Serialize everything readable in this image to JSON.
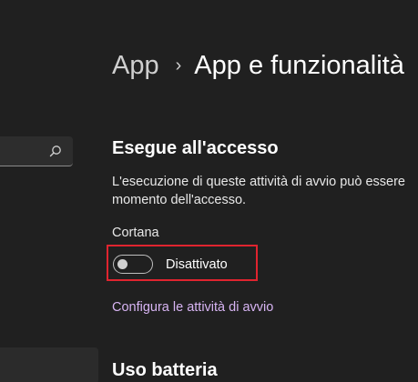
{
  "breadcrumb": {
    "parent": "App",
    "separator": "›",
    "current": "App e funzionalità"
  },
  "startup": {
    "title": "Esegue all'accesso",
    "description": "L'esecuzione di queste attività di avvio può essere\nmomento dell'accesso.",
    "app_name": "Cortana",
    "toggle_state": "Disattivato",
    "toggle_on": false,
    "configure_link": "Configura le attività di avvio"
  },
  "battery": {
    "title": "Uso batteria"
  },
  "search": {
    "icon": "search-icon"
  },
  "colors": {
    "background": "#202020",
    "link": "#d7b4f3",
    "highlight": "#e0242f"
  }
}
